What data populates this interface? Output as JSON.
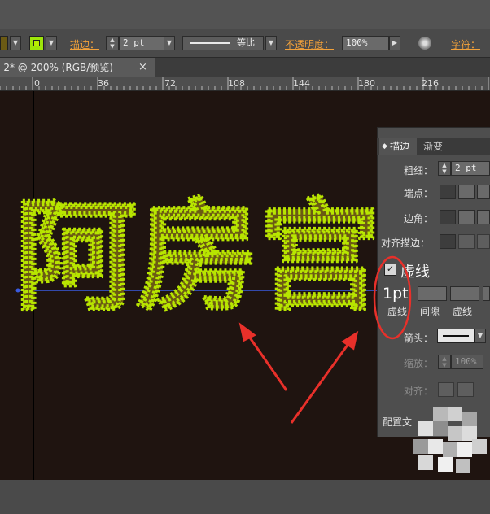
{
  "toolbar": {
    "stroke_label": "描边：",
    "stroke_weight": "2 pt",
    "profile_label": "等比",
    "opacity_label": "不透明度：",
    "opacity_value": "100%",
    "char_label": "字符："
  },
  "document": {
    "tab_title": "-2* @ 200% (RGB/预览)",
    "close_glyph": "×"
  },
  "ruler": {
    "ticks": [
      "0",
      "36",
      "72",
      "108",
      "144",
      "180",
      "216"
    ]
  },
  "artwork": {
    "text": "阿房宫",
    "fill_color": "#6b5a14",
    "stroke_color": "#b8e600"
  },
  "stroke_panel": {
    "tabs": [
      "描边",
      "渐变"
    ],
    "weight_label": "粗细：",
    "weight_value": "2 pt",
    "cap_label": "端点：",
    "corner_label": "边角：",
    "align_label": "对齐描边：",
    "dashed_label": "虚线",
    "dash_value": "1pt",
    "dash_col1": "虚线",
    "dash_col2": "间隙",
    "dash_col3": "虚线",
    "arrow_label": "箭头：",
    "scale_label": "缩放：",
    "scale_value": "100%",
    "align_arrow_label": "对齐：",
    "profile_label": "配置文"
  },
  "colors": {
    "accent_orange": "#f2a13a",
    "annotation_red": "#e8302a",
    "guide_blue": "#3a5be0"
  }
}
